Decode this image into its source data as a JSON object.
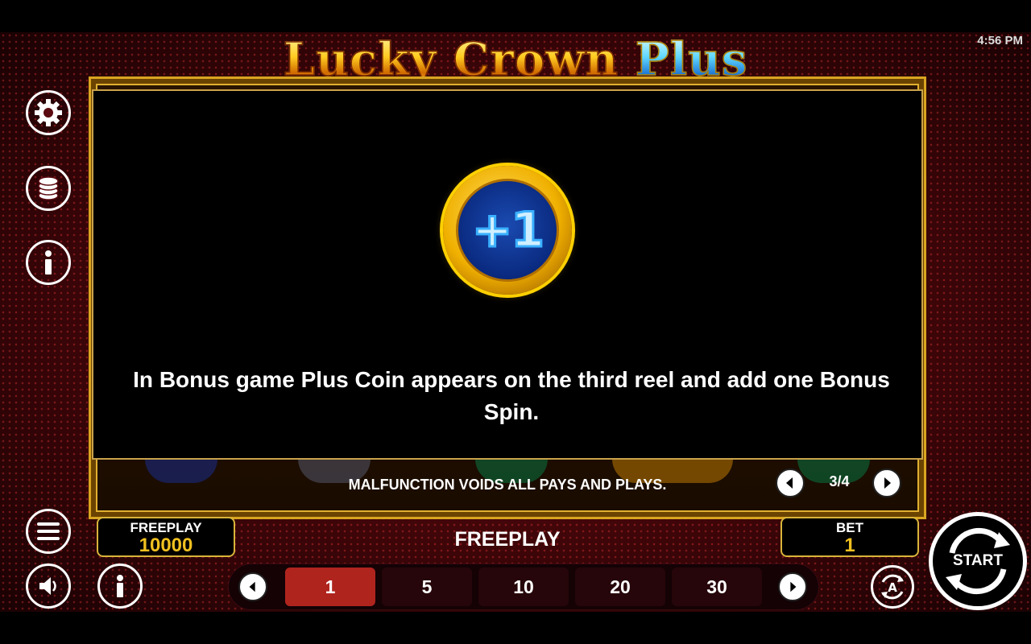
{
  "status_bar": {
    "time": "4:56 PM"
  },
  "game": {
    "title_word1": "Lucky",
    "title_word2": "Crown",
    "title_word3": "Plus"
  },
  "info_panel": {
    "coin_symbol": "+1",
    "text": "In Bonus game Plus Coin appears on the third reel and add one Bonus Spin.",
    "page_indicator": "3/4",
    "prev_icon": "chevron-left-icon",
    "next_icon": "chevron-right-icon"
  },
  "footer_notice": "MALFUNCTION VOIDS ALL PAYS AND PLAYS.",
  "left_menu": [
    {
      "name": "settings",
      "icon": "gear-icon"
    },
    {
      "name": "coins",
      "icon": "coin-stack-icon"
    },
    {
      "name": "info",
      "icon": "info-icon"
    }
  ],
  "bottom_left": {
    "menu_icon": "hamburger-menu-icon",
    "sound_icon": "speaker-icon",
    "info_icon": "info-icon"
  },
  "credit_box": {
    "label": "FREEPLAY",
    "value": "10000"
  },
  "center_label": "FREEPLAY",
  "bet_box": {
    "label": "BET",
    "value": "1"
  },
  "bet_options": [
    "1",
    "5",
    "10",
    "20",
    "30"
  ],
  "selected_bet": "1",
  "autoplay_icon": "autoplay-icon",
  "start_button": {
    "label": "START"
  },
  "colors": {
    "gold": "#d8b43a",
    "value_gold": "#f0c020",
    "active_chip": "#b0241e",
    "background_red": "#6a0a10"
  }
}
